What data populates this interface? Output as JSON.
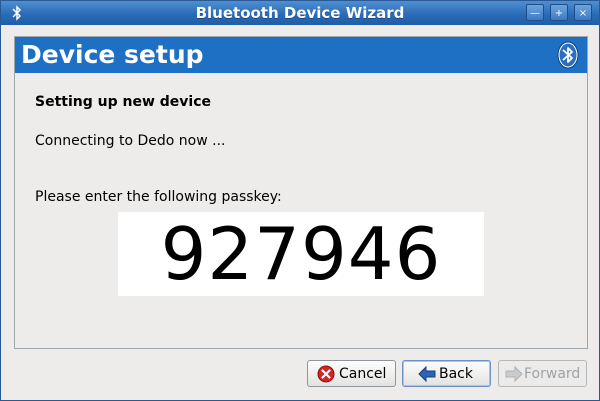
{
  "window": {
    "title": "Bluetooth Device Wizard",
    "controls": [
      "minimize-icon",
      "maximize-icon",
      "close-icon"
    ]
  },
  "header": {
    "title": "Device setup",
    "logo": "bluetooth-icon"
  },
  "body": {
    "heading": "Setting up new device",
    "status": "Connecting to Dedo now ...",
    "prompt": "Please enter the following passkey:",
    "passkey": "927946"
  },
  "buttons": {
    "cancel": "Cancel",
    "back": "Back",
    "forward": "Forward"
  },
  "colors": {
    "header_bg": "#1e70c4",
    "titlebar": "#2a6cb8"
  }
}
